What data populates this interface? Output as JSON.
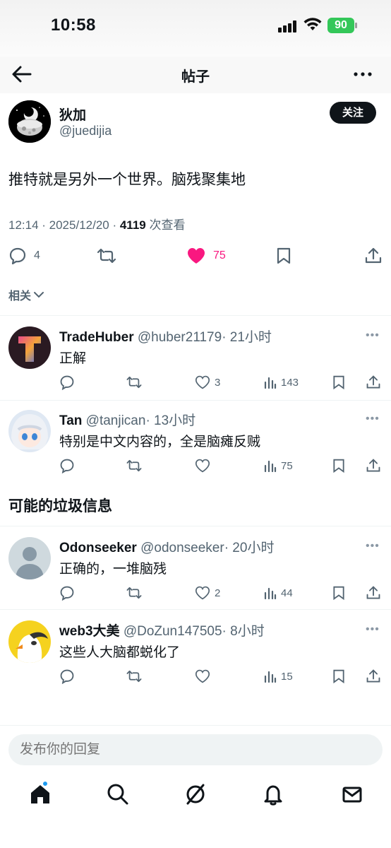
{
  "status": {
    "time": "10:58",
    "battery": "90"
  },
  "nav": {
    "title": "帖子"
  },
  "post": {
    "name": "狄加",
    "handle": "@juedijia",
    "follow_label": "关注",
    "text": "推特就是另外一个世界。脑残聚集地",
    "meta_prefix": "12:14 · 2025/12/20 · ",
    "views_num": "4119",
    "views_suffix": " 次查看",
    "replies": "4",
    "likes": "75",
    "related_label": "相关"
  },
  "replies_top": [
    {
      "name": "TradeHuber",
      "handle": "@huber21179",
      "time": "· 21小时",
      "text": "正解",
      "likes": "3",
      "views": "143"
    },
    {
      "name": "Tan",
      "handle": "@tanjican",
      "time": "· 13小时",
      "text": "特别是中文内容的，全是脑瘫反贼",
      "likes": "",
      "views": "75"
    }
  ],
  "spam_section_title": "可能的垃圾信息",
  "replies_spam": [
    {
      "name": "Odonseeker",
      "handle": "@odonseeker",
      "time": "· 20小时",
      "text": "正确的，一堆脑残",
      "likes": "2",
      "views": "44"
    },
    {
      "name": "web3大美",
      "handle": "@DoZun147505",
      "time": "· 8小时",
      "text": "这些人大脑都蜕化了",
      "likes": "",
      "views": "15"
    }
  ],
  "composer": {
    "placeholder": "发布你的回复"
  },
  "colors": {
    "like_pink": "#f91880",
    "text": "#0f1419",
    "muted": "#536471",
    "accent": "#1d9bf0"
  },
  "icons": [
    "back-arrow-icon",
    "more-icon",
    "reply-icon",
    "retweet-icon",
    "like-icon",
    "bookmark-icon",
    "share-icon",
    "views-icon",
    "home-icon",
    "search-icon",
    "grok-icon",
    "bell-icon",
    "mail-icon"
  ]
}
